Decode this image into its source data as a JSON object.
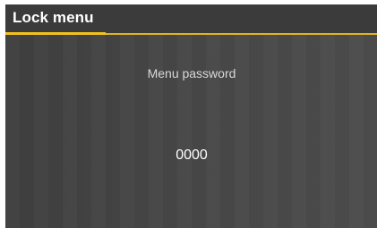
{
  "header": {
    "title": "Lock menu"
  },
  "main": {
    "label": "Menu password",
    "password_value": "0000"
  },
  "colors": {
    "background": "#474747",
    "accent": "#f2c21e",
    "text_primary": "#ffffff",
    "text_secondary": "#d8d8d8"
  }
}
